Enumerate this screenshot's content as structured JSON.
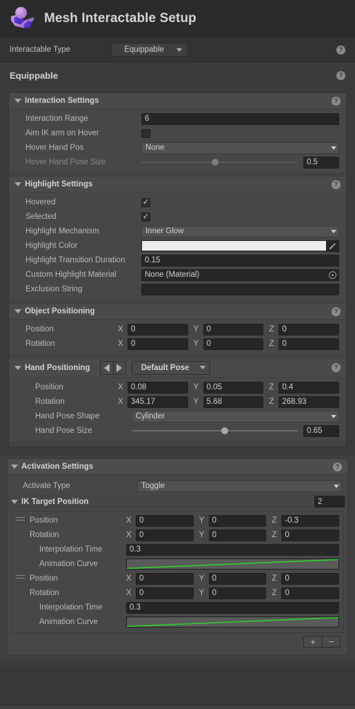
{
  "window": {
    "title": "Mesh Interactable Setup",
    "logo_icon": "mesh-person-logo-icon"
  },
  "interactable_type": {
    "label": "Interactable Type",
    "value": "Equippable",
    "help_icon": "help-icon"
  },
  "equippable": {
    "header": "Equippable",
    "help_icon": "help-icon"
  },
  "interaction_settings": {
    "title": "Interaction Settings",
    "help_icon": "help-icon",
    "rows": {
      "interaction_range": {
        "label": "Interaction Range",
        "value": "6"
      },
      "aim_ik_arm_on_hover": {
        "label": "Aim IK arm on Hover",
        "checked": false
      },
      "hover_hand_pos": {
        "label": "Hover Hand Pos",
        "value": "None"
      },
      "hover_hand_pose_size": {
        "label": "Hover Hand Pose Size",
        "value": "0.5",
        "slider_pct": 48,
        "disabled": true
      }
    }
  },
  "highlight_settings": {
    "title": "Highlight Settings",
    "help_icon": "help-icon",
    "rows": {
      "hovered": {
        "label": "Hovered",
        "checked": true
      },
      "selected": {
        "label": "Selected",
        "checked": true
      },
      "highlight_mechanism": {
        "label": "Highlight Mechanism",
        "value": "Inner Glow"
      },
      "highlight_color": {
        "label": "Highlight Color",
        "color": "#ebebeb",
        "picker_icon": "eyedropper-icon"
      },
      "highlight_transition_duration": {
        "label": "Highlight Transition Duration",
        "value": "0.15"
      },
      "custom_highlight_material": {
        "label": "Custom Highlight Material",
        "value": "None (Material)",
        "picker_icon": "object-picker-icon"
      },
      "exclusion_string": {
        "label": "Exclusion String",
        "value": ""
      }
    }
  },
  "object_positioning": {
    "title": "Object Positioning",
    "help_icon": "help-icon",
    "position": {
      "label": "Position",
      "x": "0",
      "y": "0",
      "z": "0"
    },
    "rotation": {
      "label": "Rotation",
      "x": "0",
      "y": "0",
      "z": "0"
    },
    "axis_labels": {
      "x": "X",
      "y": "Y",
      "z": "Z"
    }
  },
  "hand_positioning": {
    "title": "Hand Positioning",
    "help_icon": "help-icon",
    "prev_icon": "arrow-left-icon",
    "next_icon": "arrow-right-icon",
    "pose_selector": "Default Pose",
    "position": {
      "label": "Position",
      "x": "0.08",
      "y": "0.05",
      "z": "0.4"
    },
    "rotation": {
      "label": "Rotation",
      "x": "345.17",
      "y": "5.68",
      "z": "268.93"
    },
    "hand_pose_shape": {
      "label": "Hand Pose Shape",
      "value": "Cylinder"
    },
    "hand_pose_size": {
      "label": "Hand Pose Size",
      "value": "0.65",
      "slider_pct": 65
    }
  },
  "activation_settings": {
    "title": "Activation Settings",
    "help_icon": "help-icon",
    "activate_type": {
      "label": "Activate Type",
      "value": "Toggle"
    },
    "ik_target_position": {
      "title": "IK Target Position",
      "count": "2",
      "items": [
        {
          "handle_icon": "drag-handle-icon",
          "position": {
            "label": "Position",
            "x": "0",
            "y": "0",
            "z": "-0.3"
          },
          "rotation": {
            "label": "Rotation",
            "x": "0",
            "y": "0",
            "z": "0"
          },
          "interpolation_time": {
            "label": "Interpolation Time",
            "value": "0.3"
          },
          "animation_curve": {
            "label": "Animation Curve",
            "curve_color": "#2fd12f"
          }
        },
        {
          "handle_icon": "drag-handle-icon",
          "position": {
            "label": "Position",
            "x": "0",
            "y": "0",
            "z": "0"
          },
          "rotation": {
            "label": "Rotation",
            "x": "0",
            "y": "0",
            "z": "0"
          },
          "interpolation_time": {
            "label": "Interpolation Time",
            "value": "0.3"
          },
          "animation_curve": {
            "label": "Animation Curve",
            "curve_color": "#2fd12f"
          }
        }
      ],
      "add_label": "+",
      "remove_label": "−"
    }
  },
  "glyphs": {
    "help": "?"
  }
}
